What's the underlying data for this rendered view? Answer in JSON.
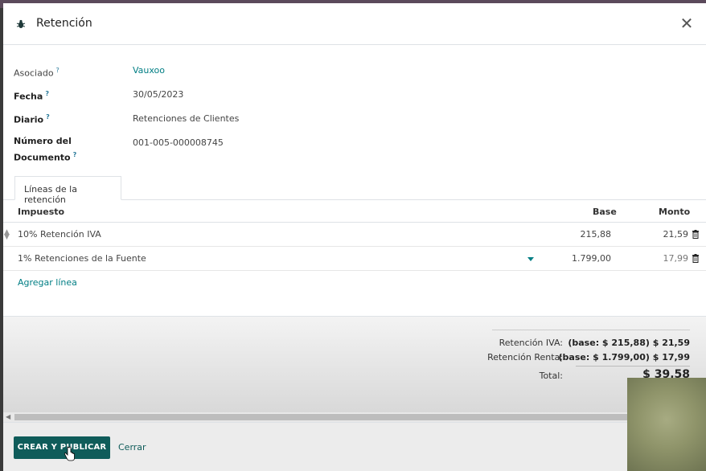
{
  "modal": {
    "title": "Retención",
    "icon": "bug-icon",
    "close_icon": "close-icon"
  },
  "fields": {
    "asociado": {
      "label": "Asociado",
      "value": "Vauxoo"
    },
    "fecha": {
      "label": "Fecha",
      "value": "30/05/2023"
    },
    "diario": {
      "label": "Diario",
      "value": "Retenciones de Clientes"
    },
    "numero_line1": "Número del",
    "numero_line2": "Documento",
    "numero_value": "001-005-000008745",
    "help": "?"
  },
  "tabs": [
    {
      "label": "Líneas de la retención"
    }
  ],
  "table": {
    "headers": {
      "impuesto": "Impuesto",
      "base": "Base",
      "monto": "Monto"
    },
    "rows": [
      {
        "impuesto": "10% Retención IVA",
        "base": "215,88",
        "monto": "21,59"
      },
      {
        "impuesto": "1% Retenciones de la Fuente",
        "base": "1.799,00",
        "monto": "17,99"
      }
    ],
    "add_line": "Agregar línea"
  },
  "totals": {
    "iva_label": "Retención IVA:",
    "iva_value": "(base: $ 215,88) $ 21,59",
    "renta_label": "Retención Renta:",
    "renta_value": "(base: $ 1.799,00) $ 17,99",
    "total_label": "Total:",
    "total_value": "$ 39,58"
  },
  "footer": {
    "primary_button": "CREAR Y PUBLICAR",
    "cancel_button": "Cerrar"
  },
  "colors": {
    "accent": "#017e84",
    "primary_button": "#0f5c5a"
  }
}
